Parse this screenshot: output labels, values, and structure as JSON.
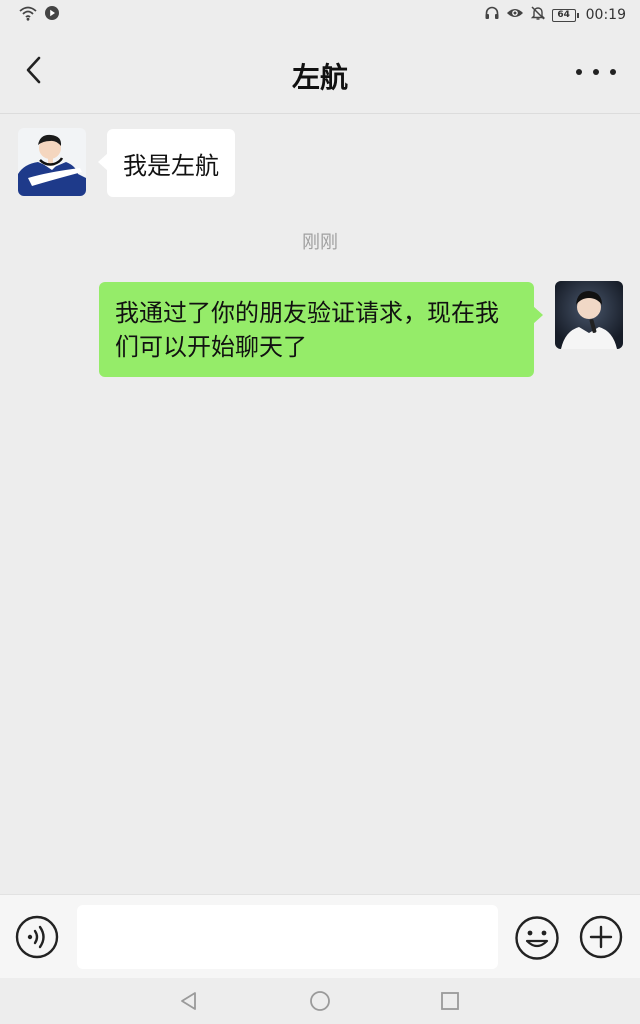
{
  "status_bar": {
    "time": "00:19",
    "battery_level": "64",
    "icons": [
      "wifi-icon",
      "play-icon",
      "headset-icon",
      "eye-icon",
      "bell-muted-icon",
      "battery-icon"
    ]
  },
  "header": {
    "title": "左航",
    "back_icon": "chevron-left-icon",
    "more_icon": "more-horizontal-icon"
  },
  "messages": [
    {
      "direction": "incoming",
      "text": "我是左航",
      "avatar": "contact-avatar"
    },
    {
      "type": "timestamp",
      "text": "刚刚"
    },
    {
      "direction": "outgoing",
      "text": "我通过了你的朋友验证请求，现在我们可以开始聊天了",
      "avatar": "self-avatar"
    }
  ],
  "colors": {
    "background": "#ededed",
    "incoming_bubble": "#ffffff",
    "outgoing_bubble": "#95ec69",
    "input_bar": "#f6f6f6"
  },
  "input_bar": {
    "value": "",
    "placeholder": "",
    "icons": [
      "voice-icon",
      "emoji-icon",
      "plus-icon"
    ]
  },
  "system_nav": {
    "icons": [
      "nav-back-icon",
      "nav-home-icon",
      "nav-recent-icon"
    ]
  }
}
